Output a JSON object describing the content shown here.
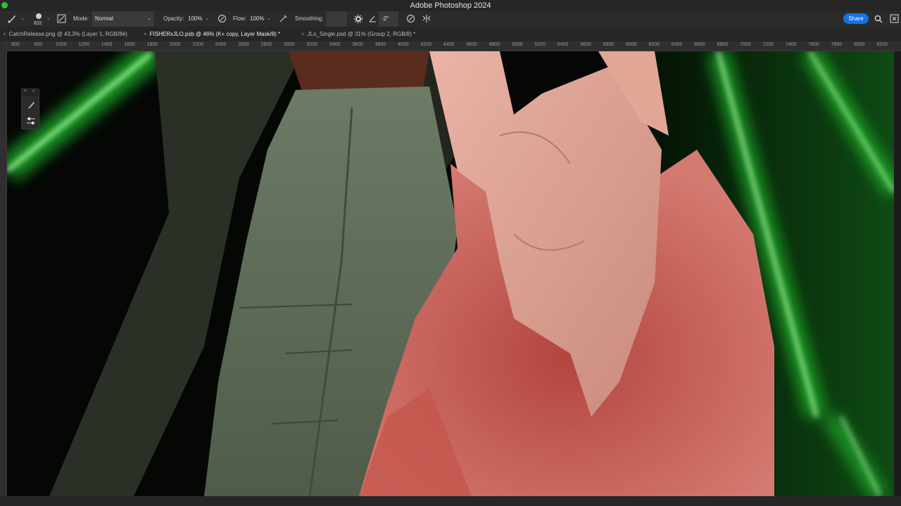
{
  "app": {
    "title": "Adobe Photoshop 2024"
  },
  "options_bar": {
    "brush_size": "832",
    "mode_label": "Mode:",
    "mode_value": "Normal",
    "opacity_label": "Opacity:",
    "opacity_value": "100%",
    "flow_label": "Flow:",
    "flow_value": "100%",
    "smoothing_label": "Smoothing:",
    "angle_value": "-2°",
    "share_label": "Share"
  },
  "tabs": [
    {
      "label": "CatchRelease.png @ 43,3% (Layer 1, RGB/8#)",
      "active": false
    },
    {
      "label": "FISHERxJLO.psb @ 46% (K+  copy, Layer Mask/8) *",
      "active": true
    },
    {
      "label": "JLo_Single.psd @ 31% (Group 2, RGB/8) *",
      "active": false
    }
  ],
  "ruler_ticks": [
    "600",
    "800",
    "1000",
    "1200",
    "1400",
    "1600",
    "1800",
    "2000",
    "2200",
    "2400",
    "2600",
    "2800",
    "3000",
    "3200",
    "3400",
    "3600",
    "3800",
    "4000",
    "4200",
    "4400",
    "4600",
    "4800",
    "5000",
    "5200",
    "5400",
    "5600",
    "5800",
    "6000",
    "6200",
    "6400",
    "6600",
    "6800",
    "7000",
    "7200",
    "7400",
    "7600",
    "7800",
    "8000",
    "8200"
  ],
  "icons": {
    "brush": "brush-icon",
    "brush_settings": "brush-settings-icon",
    "opacity_pressure": "pressure-opacity-icon",
    "flow_airbrush": "airbrush-icon",
    "smoothing_settings": "gear-icon",
    "angle": "angle-icon",
    "size_pressure": "pressure-size-icon",
    "symmetry": "symmetry-icon",
    "search": "search-icon",
    "help": "help-icon"
  },
  "colors": {
    "accent": "#1473e6",
    "neon_green": "#2bff3a",
    "fur_pink": "#c86a63",
    "denim_green": "#5f6e58"
  }
}
